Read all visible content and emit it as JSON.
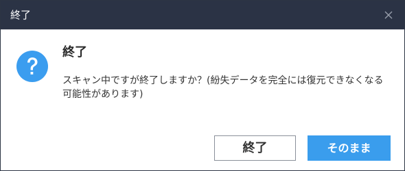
{
  "window": {
    "title": "終了"
  },
  "dialog": {
    "heading": "終了",
    "message": "スキャン中ですが終了しますか？(紛失データを完全には復元できなくなる可能性があります)",
    "icon": "question-icon"
  },
  "buttons": {
    "quit_label": "終了",
    "continue_label": "そのまま"
  },
  "colors": {
    "titlebar": "#2b3345",
    "accent": "#3a9ded",
    "icon": "#3b9def"
  }
}
